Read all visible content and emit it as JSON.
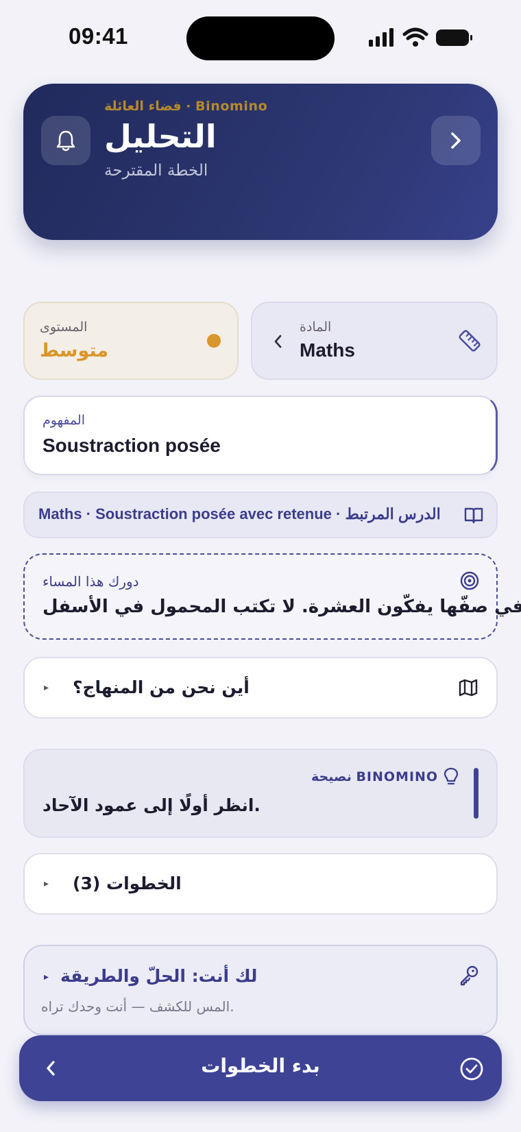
{
  "status_bar": {
    "time": "09:41"
  },
  "header": {
    "caption": "فضاء العائلة · Binomino",
    "title": "التحليل",
    "subtitle": "الخطة المقترحة"
  },
  "subject_card": {
    "label": "المادة",
    "value": "Maths"
  },
  "level_card": {
    "label": "المستوى",
    "value": "متوسط",
    "color": "#d9962a"
  },
  "concept_card": {
    "label": "المفهوم",
    "value": "Soustraction posée"
  },
  "lesson_chip": {
    "text": "Maths · Soustraction posée avec retenue · الدرس المرتبط"
  },
  "role_card": {
    "label": "دورك هذا المساء",
    "text": "في صفّها يفكّون العشرة. لا تكتب المحمول في الأسفل."
  },
  "curriculum": {
    "title": "أين نحن من المنهاج؟"
  },
  "tip": {
    "label": "نصيحة BINOMINO",
    "text": "انظر أولًا إلى عمود الآحاد."
  },
  "steps": {
    "title": "الخطوات (3)"
  },
  "reveal": {
    "title": "لك أنت: الحلّ والطريقة",
    "subtitle": "المس للكشف — أنت وحدك تراه."
  },
  "cta": {
    "label": "بدء الخطوات"
  },
  "colors": {
    "primary": "#3f4396",
    "header_bg": "#252e62",
    "accent": "#d9962a"
  }
}
